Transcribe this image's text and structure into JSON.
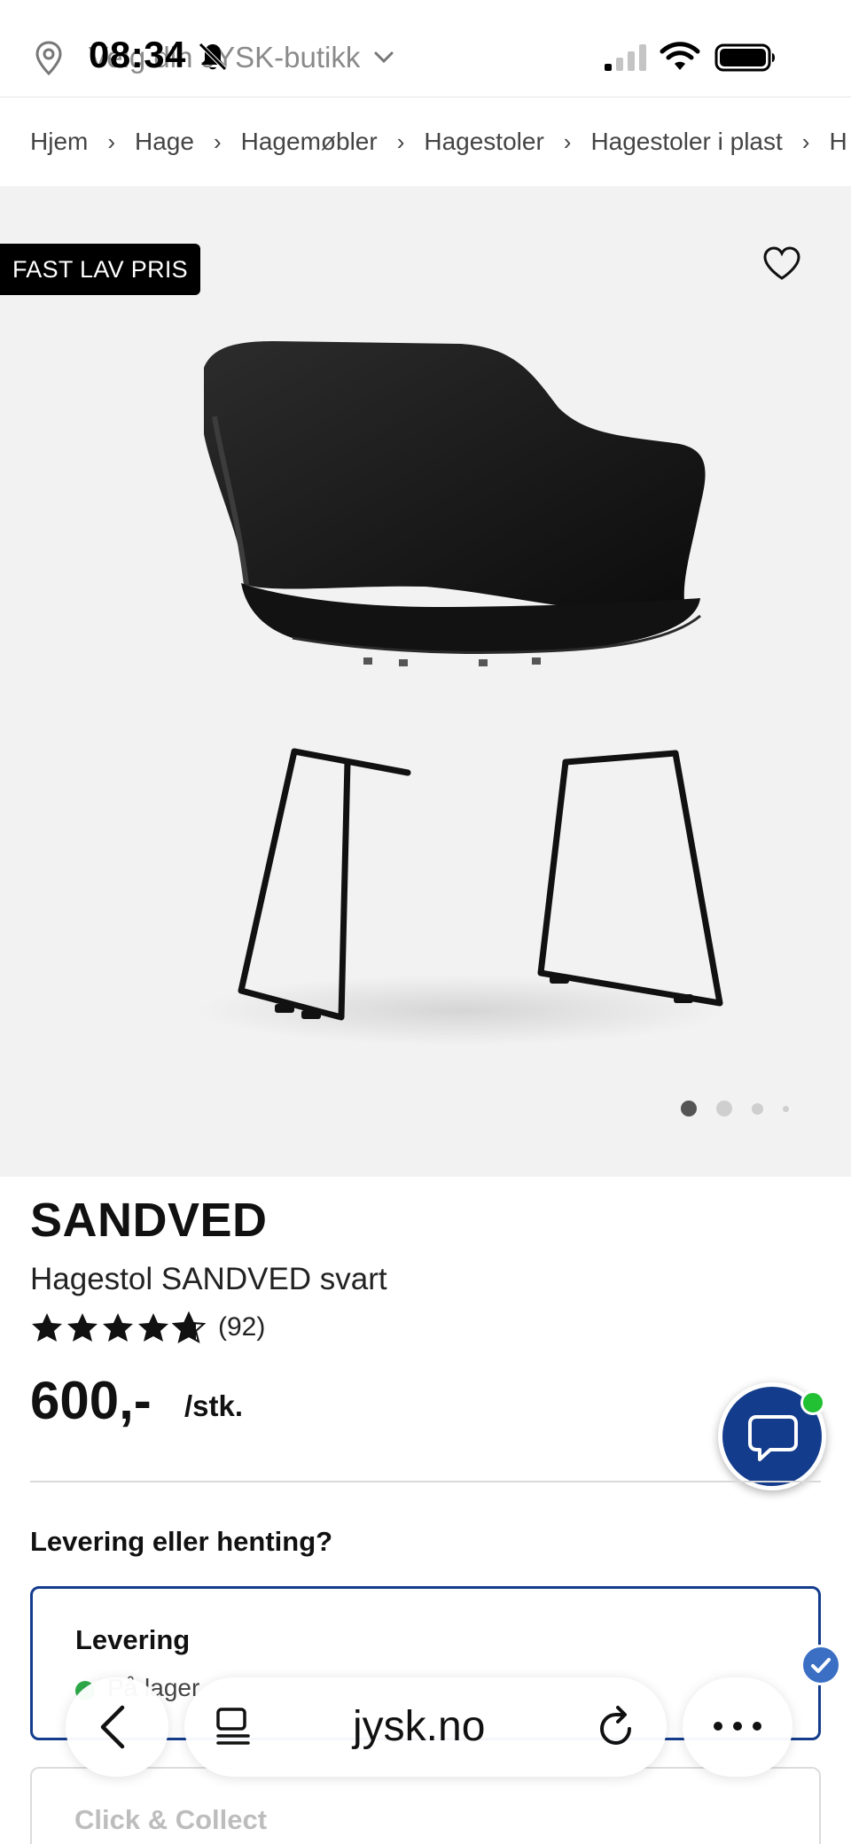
{
  "status_bar": {
    "time": "08:34"
  },
  "store_selector": {
    "label": "Velg din JYSK-butikk"
  },
  "breadcrumb": {
    "items": [
      "Hjem",
      "Hage",
      "Hagemøbler",
      "Hagestoler",
      "Hagestoler i plast",
      "H"
    ],
    "separator": "›"
  },
  "product": {
    "badge": "FAST LAV PRIS",
    "name": "SANDVED",
    "description": "Hagestol SANDVED svart",
    "rating": 4.5,
    "rating_count": "(92)",
    "price": "600,-",
    "unit": "/stk.",
    "image_count": 4,
    "active_image": 1
  },
  "fulfillment": {
    "question": "Levering eller henting?",
    "options": [
      {
        "title": "Levering",
        "stock": "På lager"
      },
      {
        "title": "Click & Collect"
      }
    ]
  },
  "browser": {
    "url": "jysk.no"
  },
  "colors": {
    "brand_blue": "#143c8c",
    "online_green": "#22c033",
    "stock_green": "#2eaa4a",
    "badge_black": "#000000"
  }
}
